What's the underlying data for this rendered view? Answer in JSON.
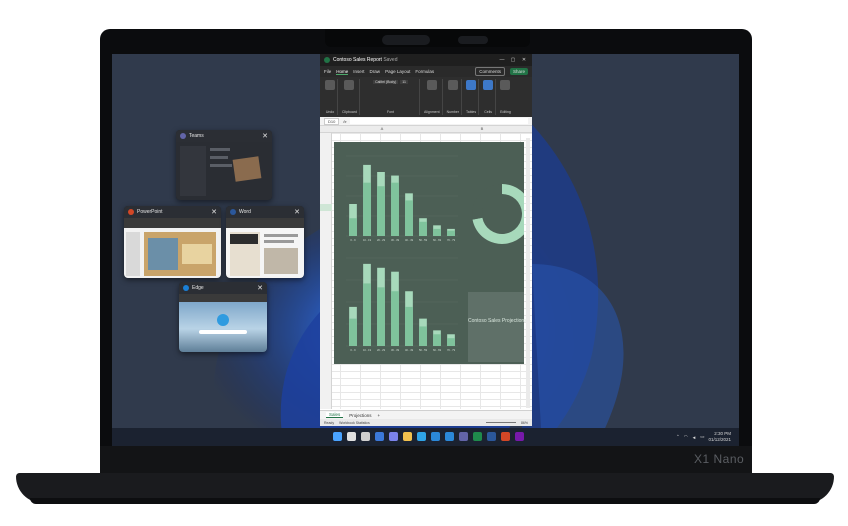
{
  "device": {
    "model_logo": "X1 Nano"
  },
  "snap_windows": {
    "teams": {
      "title": "Teams",
      "close": "✕",
      "icon_color": "#6264a7"
    },
    "powerpoint": {
      "title": "PowerPoint",
      "close": "✕",
      "icon_color": "#d24726"
    },
    "word": {
      "title": "Word",
      "close": "✕",
      "icon_color": "#2b579a"
    },
    "edge": {
      "title": "Edge",
      "close": "✕",
      "icon_color": "#1a7fd6"
    }
  },
  "excel": {
    "title": "Contoso Sales Report",
    "save_state": "Saved",
    "window_controls": [
      "—",
      "▢",
      "✕"
    ],
    "menu": [
      "File",
      "Home",
      "Insert",
      "Draw",
      "Page Layout",
      "Formulas"
    ],
    "active_menu": "Home",
    "comments_label": "Comments",
    "share_label": "Share",
    "ribbon_groups": [
      "Undo",
      "Clipboard",
      "Font",
      "Alignment",
      "Number",
      "Tables",
      "Cells",
      "Editing"
    ],
    "font_name": "Calibri (Body)",
    "font_size": "11",
    "name_box": "D10",
    "fx_label": "fx",
    "columns": [
      "A",
      "B"
    ],
    "sheet_tabs": [
      "Sales",
      "Projections"
    ],
    "active_sheet": "Sales",
    "add_sheet": "+",
    "status_ready": "Ready",
    "status_stats": "Workbook Statistics",
    "zoom": "86%",
    "accent_color": "#217346"
  },
  "chart_data": [
    {
      "type": "bar",
      "categories": [
        "0 - 9",
        "10 - 19",
        "20 - 29",
        "30 - 39",
        "40 - 49",
        "50 - 59",
        "60 - 69",
        "70 - 79"
      ],
      "series": [
        {
          "values": [
            18,
            40,
            36,
            34,
            24,
            10,
            6,
            4
          ]
        },
        {
          "values": [
            10,
            30,
            28,
            30,
            20,
            8,
            4,
            3
          ]
        }
      ],
      "ylim": [
        0,
        45
      ],
      "colors": [
        "#a7d9bb",
        "#7fc39c"
      ]
    },
    {
      "type": "bar",
      "categories": [
        "0 - 9",
        "10 - 19",
        "20 - 29",
        "30 - 39",
        "40 - 49",
        "50 - 59",
        "60 - 69",
        "70 - 79"
      ],
      "series": [
        {
          "values": [
            20,
            42,
            40,
            38,
            28,
            14,
            8,
            6
          ]
        },
        {
          "values": [
            14,
            32,
            30,
            28,
            20,
            10,
            6,
            4
          ]
        }
      ],
      "ylim": [
        0,
        45
      ],
      "colors": [
        "#a7d9bb",
        "#7fc39c"
      ]
    },
    {
      "type": "pie",
      "values": [
        72,
        28
      ],
      "labels": [
        "",
        ""
      ],
      "colors": [
        "#a7d9bb",
        "#4c5f55"
      ]
    }
  ],
  "chart_panel": {
    "caption": "Contoso Sales Projections"
  },
  "taskbar": {
    "icons": [
      "windows-start",
      "search",
      "task-view",
      "widgets",
      "chat",
      "file-explorer",
      "edge",
      "store",
      "mail",
      "teams",
      "excel",
      "word",
      "powerpoint",
      "onenote"
    ],
    "icon_colors": [
      "#4aa3ff",
      "#e0e0e0",
      "#cfcfcf",
      "#3b78d8",
      "#7b83eb",
      "#f2c14e",
      "#2fa4e7",
      "#2b88d8",
      "#2b88d8",
      "#6264a7",
      "#1f8a4c",
      "#2b579a",
      "#d24726",
      "#7719aa"
    ],
    "time": "2:30 PM",
    "date": "01/12/2021",
    "tray_up": "⌃",
    "tray_wifi": "◠",
    "tray_volume": "◄",
    "tray_battery": "▭"
  }
}
